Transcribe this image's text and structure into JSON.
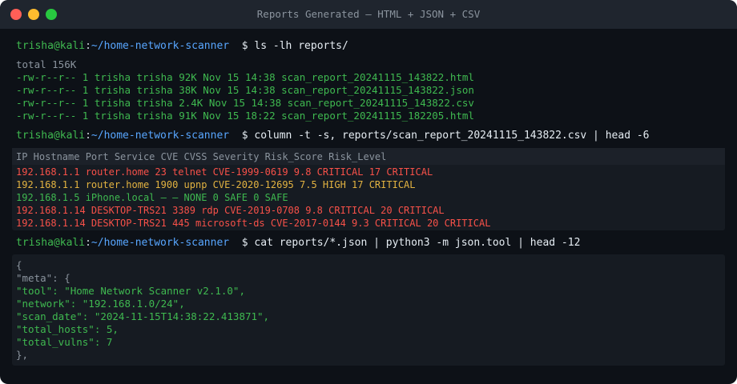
{
  "window": {
    "title": "Reports Generated — HTML + JSON + CSV"
  },
  "prompt": {
    "user": "trisha@kali",
    "colon": ":",
    "path": "~/home-network-scanner",
    "symbol": "$"
  },
  "commands": {
    "ls": "ls -lh reports/",
    "column": "column -t -s, reports/scan_report_20241115_143822.csv | head -6",
    "cat": "cat reports/*.json | python3 -m json.tool | head -12"
  },
  "ls_output": {
    "total": "total 156K",
    "files": [
      "-rw-r--r-- 1 trisha trisha 92K Nov 15 14:38 scan_report_20241115_143822.html",
      "-rw-r--r-- 1 trisha trisha 38K Nov 15 14:38 scan_report_20241115_143822.json",
      "-rw-r--r-- 1 trisha trisha 2.4K Nov 15 14:38 scan_report_20241115_143822.csv",
      "-rw-r--r-- 1 trisha trisha 91K Nov 15 18:22 scan_report_20241115_182205.html"
    ]
  },
  "csv_output": {
    "header": "IP Hostname Port Service CVE CVSS Severity Risk_Score Risk_Level",
    "rows": [
      {
        "text": "192.168.1.1 router.home 23 telnet CVE-1999-0619 9.8 CRITICAL 17 CRITICAL",
        "level": "CRITICAL"
      },
      {
        "text": "192.168.1.1 router.home 1900 upnp CVE-2020-12695 7.5 HIGH 17 CRITICAL",
        "level": "HIGH"
      },
      {
        "text": "192.168.1.5 iPhone.local — — NONE 0 SAFE 0 SAFE",
        "level": "SAFE"
      },
      {
        "text": "192.168.1.14 DESKTOP-TRS21 3389 rdp CVE-2019-0708 9.8 CRITICAL 20 CRITICAL",
        "level": "CRITICAL"
      },
      {
        "text": "192.168.1.14 DESKTOP-TRS21 445 microsoft-ds CVE-2017-0144 9.3 CRITICAL 20 CRITICAL",
        "level": "CRITICAL"
      }
    ]
  },
  "json_output": {
    "lines": [
      "{",
      "\"meta\": {",
      "\"tool\": \"Home Network Scanner v2.1.0\",",
      "\"network\": \"192.168.1.0/24\",",
      "\"scan_date\": \"2024-11-15T14:38:22.413871\",",
      "\"total_hosts\": 5,",
      "\"total_vulns\": 7",
      "},"
    ]
  },
  "colors": {
    "background": "#0d1117",
    "prompt_user": "#3fb950",
    "prompt_path": "#58a6ff",
    "critical": "#f85149",
    "high": "#e3b341",
    "safe": "#3fb950"
  }
}
